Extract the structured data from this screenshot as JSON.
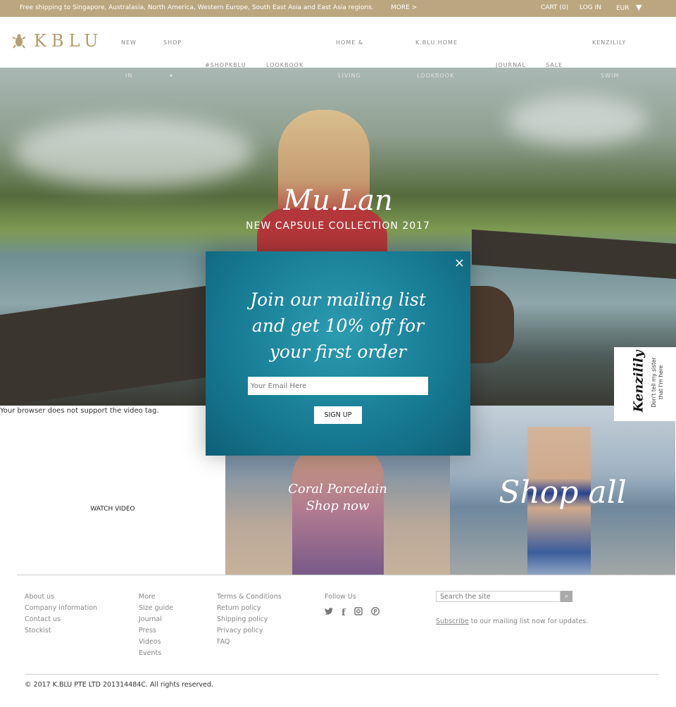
{
  "topbar": {
    "shipping": "Free shipping to Singapore, Australasia, North America, Western Europe, South East Asia and East Asia regions.",
    "more": "MORE >",
    "cart": "CART (0)",
    "login": "LOG IN",
    "currency": "EUR"
  },
  "header": {
    "logo": "KBLU",
    "nav": [
      {
        "label": "NEW",
        "label2": "IN"
      },
      {
        "label": "SHOP",
        "label2": "▾"
      },
      {
        "label": "#SHOPKBLU"
      },
      {
        "label": "LOOKBOOK"
      },
      {
        "label": "HOME &",
        "label2": "LIVING"
      },
      {
        "label": "K.BLU HOME",
        "label2": "LOOKBOOK"
      },
      {
        "label": "JOURNAL"
      },
      {
        "label": "SALE"
      },
      {
        "label": "KENZILILY",
        "label2": "SWIM"
      }
    ]
  },
  "hero": {
    "title": "Mu.Lan",
    "subtitle": "NEW CAPSULE COLLECTION 2017",
    "video_fallback": "Your browser does not support the video tag."
  },
  "tiles": {
    "watch": "WATCH VIDEO",
    "coral1": "Coral Porcelain",
    "coral2": "Shop now",
    "shopall": "Shop all"
  },
  "popup": {
    "heading1": "Join our mailing list",
    "heading2": "and get 10% off for",
    "heading3": "your first order",
    "email_placeholder": "Your Email Here",
    "signup": "SIGN UP",
    "close": "×"
  },
  "kenzilily": {
    "logo": "Kenzilily",
    "line1": "Don't tell my sister",
    "line2": "that I'm here"
  },
  "footer": {
    "col1": [
      "About us",
      "Company information",
      "Contact us",
      "Stockist"
    ],
    "col2": [
      "More",
      "Size guide",
      "Journal",
      "Press",
      "Videos",
      "Events"
    ],
    "col3": [
      "Terms & Conditions",
      "Return policy",
      "Shipping policy",
      "Privacy policy",
      "FAQ"
    ],
    "follow": "Follow Us",
    "search_placeholder": "Search the site",
    "subscribe_link": "Subscribe",
    "subscribe_text": " to our mailing list now for updates.",
    "copyright": "© 2017 K.BLU PTE LTD 201314484C. All rights reserved."
  },
  "colors": {
    "brand_gold": "#bba77f"
  }
}
